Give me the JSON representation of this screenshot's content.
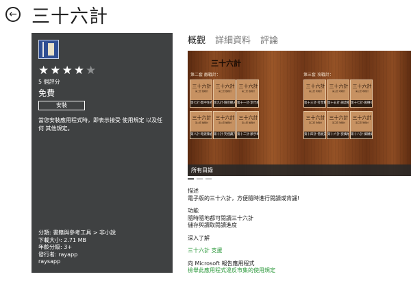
{
  "header": {
    "title": "三十六計"
  },
  "left": {
    "rating_count": "5 個評分",
    "price": "免費",
    "install_label": "安裝",
    "terms": "當您安裝應用程式時，即表示接受 使用規定 以及任何 其他規定。",
    "meta": [
      "分類: 書籍與參考工具 > 非小說",
      "下載大小: 2.71 MB",
      "年齡分級: 3+",
      "發行者: rayapp",
      "raysapp"
    ]
  },
  "tabs": [
    "概觀",
    "詳細資料",
    "評論"
  ],
  "screenshot": {
    "title": "三十六計",
    "sec1": "第二套 敵戰計：",
    "sec2": "第三套 攻戰計：",
    "tile_heading": "三十六計",
    "tile_sub1": "第二套 敵戰計",
    "tile_sub2": "第三套 攻戰計",
    "captions": [
      "第七計·無中生有",
      "第八計·暗渡陳倉",
      "第九計·隔岸觀火",
      "第十計·笑裡藏刀",
      "第十一計·李代桃僵",
      "第十二計·順手牽羊",
      "第十三計·打草驚蛇",
      "第十四計·借屍還魂",
      "第十五計·調虎離山",
      "第十六計·欲擒故縱",
      "第十七計·拋磚引玉",
      "第十八計·擒賊擒王"
    ],
    "bottom_bar": "所有目錄"
  },
  "description": {
    "desc_heading": "描述",
    "desc_text": "電子版的三十六計，方便隨時進行閱讀或背誦!",
    "features_heading": "功能",
    "feature1": "隨時隨地都可閱讀三十六計",
    "feature2": "儲存與讀取閱讀進度",
    "learn_heading": "深入了解",
    "support_link": "三十六計 支援",
    "report_heading": "向 Microsoft 報告應用程式",
    "report_link": "檢舉此應用程式違反市集的使用規定"
  }
}
